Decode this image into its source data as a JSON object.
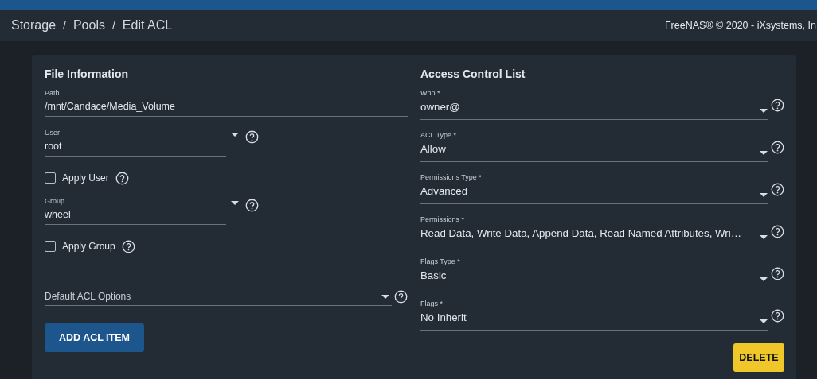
{
  "breadcrumb": [
    {
      "label": "Storage",
      "separator": "/"
    },
    {
      "label": "Pools",
      "separator": "/"
    },
    {
      "label": "Edit ACL"
    }
  ],
  "copyright": "FreeNAS® © 2020 - iXsystems, In",
  "file_information": {
    "title": "File Information",
    "fields": [
      {
        "kind": "text",
        "label": "Path",
        "value": "/mnt/Candace/Media_Volume"
      },
      {
        "kind": "select",
        "label": "User",
        "value": "root"
      },
      {
        "kind": "checkbox",
        "label": "Apply User",
        "checked": false
      },
      {
        "kind": "select",
        "label": "Group",
        "value": "wheel"
      },
      {
        "kind": "checkbox",
        "label": "Apply Group",
        "checked": false
      },
      {
        "kind": "placeholder_select",
        "placeholder": "Default ACL Options"
      }
    ],
    "button": "ADD ACL ITEM"
  },
  "access_control_list": {
    "title": "Access Control List",
    "fields": [
      {
        "label": "Who *",
        "value": "owner@"
      },
      {
        "label": "ACL Type *",
        "value": "Allow"
      },
      {
        "label": "Permissions Type *",
        "value": "Advanced"
      },
      {
        "label": "Permissions *",
        "value": "Read Data, Write Data, Append Data, Read Named Attributes, Wri…"
      },
      {
        "label": "Flags Type *",
        "value": "Basic"
      },
      {
        "label": "Flags *",
        "value": "No Inherit"
      }
    ],
    "button": "DELETE"
  }
}
